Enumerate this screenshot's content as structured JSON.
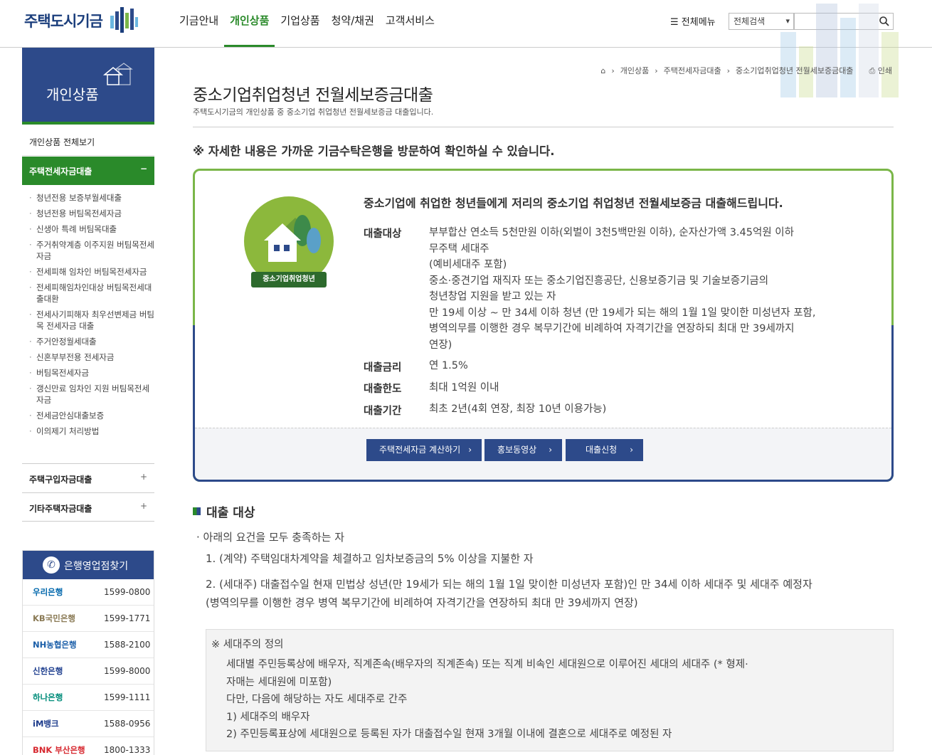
{
  "header": {
    "logo_text": "주택도시기금",
    "nav": [
      "기금안내",
      "개인상품",
      "기업상품",
      "청약/채권",
      "고객서비스"
    ],
    "all_menu": "전체메뉴",
    "search_select": "전체검색",
    "search_placeholder": ""
  },
  "sidebar": {
    "title": "개인상품",
    "all_link": "개인상품 전체보기",
    "active_section": "주택전세자금대출",
    "active_sign": "−",
    "sub_items": [
      "청년전용 보증부월세대출",
      "청년전용 버팀목전세자금",
      "신생아 특례 버팀목대출",
      "주거취약계층 이주지원 버팀목전세자금",
      "전세피해 임차인 버팀목전세자금",
      "전세피해임차인대상 버팀목전세대출대환",
      "전세사기피해자 최우선변제금 버팀목 전세자금 대출",
      "주거안정월세대출",
      "신혼부부전용 전세자금",
      "버팀목전세자금",
      "갱신만료 임차인 지원 버팀목전세자금",
      "전세금안심대출보증",
      "이의제기 처리방법"
    ],
    "sections": [
      {
        "label": "주택구입자금대출",
        "sign": "+"
      },
      {
        "label": "기타주택자금대출",
        "sign": "+"
      }
    ],
    "bank_finder": {
      "title": "은행영업점찾기",
      "banks": [
        {
          "name": "우리은행",
          "phone": "1599-0800",
          "color": "#0067ac"
        },
        {
          "name": "KB국민은행",
          "phone": "1599-1771",
          "color": "#8a7a55"
        },
        {
          "name": "NH농협은행",
          "phone": "1588-2100",
          "color": "#1a5ea8"
        },
        {
          "name": "신한은행",
          "phone": "1599-8000",
          "color": "#1f3f8f"
        },
        {
          "name": "하나은행",
          "phone": "1599-1111",
          "color": "#008c7a"
        },
        {
          "name": "iM뱅크",
          "phone": "1588-0956",
          "color": "#1d3c8c"
        },
        {
          "name": "BNK 부산은행",
          "phone": "1800-1333",
          "color": "#d7282f"
        }
      ]
    }
  },
  "breadcrumb": [
    "개인상품",
    "주택전세자금대출",
    "중소기업취업청년 전월세보증금대출"
  ],
  "print_label": "인쇄",
  "page": {
    "title": "중소기업취업청년 전월세보증금대출",
    "desc": "주택도시기금의 개인상품 중 중소기업 취업청년 전월세보증금 대출입니다.",
    "notice": "※ 자세한 내용은 가까운 기금수탁은행을 방문하여 확인하실 수 있습니다."
  },
  "card": {
    "emblem_label": "중소기업취업청년",
    "lead": "중소기업에 취업한 청년들에게 저리의 중소기업 취업청년 전월세보증금 대출해드립니다.",
    "rows": [
      {
        "label": "대출대상",
        "lines": [
          "부부합산 연소득 5천만원 이하(외벌이 3천5백만원 이하), 순자산가액 3.45억원 이하",
          "무주택 세대주",
          "(예비세대주 포함)",
          "중소·중견기업 재직자 또는 중소기업진흥공단, 신용보증기금 및 기술보증기금의",
          "청년창업 지원을 받고 있는 자",
          "만 19세 이상 ~ 만 34세 이하 청년 (만 19세가 되는 해의 1월 1일 맞이한 미성년자 포함,",
          "병역의무를 이행한 경우 복무기간에 비례하여 자격기간을 연장하되 최대 만 39세까지",
          "연장)"
        ]
      },
      {
        "label": "대출금리",
        "lines": [
          "연 1.5%"
        ]
      },
      {
        "label": "대출한도",
        "lines": [
          "최대 1억원 이내"
        ]
      },
      {
        "label": "대출기간",
        "lines": [
          "최초 2년(4회 연장, 최장 10년 이용가능)"
        ]
      }
    ],
    "buttons": [
      "주택전세자금 계산하기",
      "홍보동영상",
      "대출신청"
    ]
  },
  "section": {
    "heading": "대출 대상",
    "bullet": "아래의 요건을 모두 충족하는 자",
    "conditions": [
      "1. (계약) 주택임대차계약을 체결하고 임차보증금의 5% 이상을 지불한 자",
      "2. (세대주) 대출접수일 현재 민법상 성년(만 19세가 되는 해의 1월 1일 맞이한 미성년자 포함)인 만 34세 이하 세대주 및 세대주 예정자",
      "(병역의무를 이행한 경우 병역 복무기간에 비례하여 자격기간을 연장하되 최대 만 39세까지 연장)"
    ],
    "definition_title": "※ 세대주의 정의",
    "definition_lines": [
      "세대별 주민등록상에 배우자, 직계존속(배우자의 직계존속) 또는 직계 비속인 세대원으로 이루어진 세대의 세대주 (* 형제·",
      "자매는 세대원에 미포함)",
      "다만, 다음에 해당하는 자도 세대주로 간주",
      "1) 세대주의 배우자",
      "2) 주민등록표상에 세대원으로 등록된 자가 대출접수일 현재 3개월 이내에 결혼으로 세대주로 예정된 자"
    ]
  }
}
